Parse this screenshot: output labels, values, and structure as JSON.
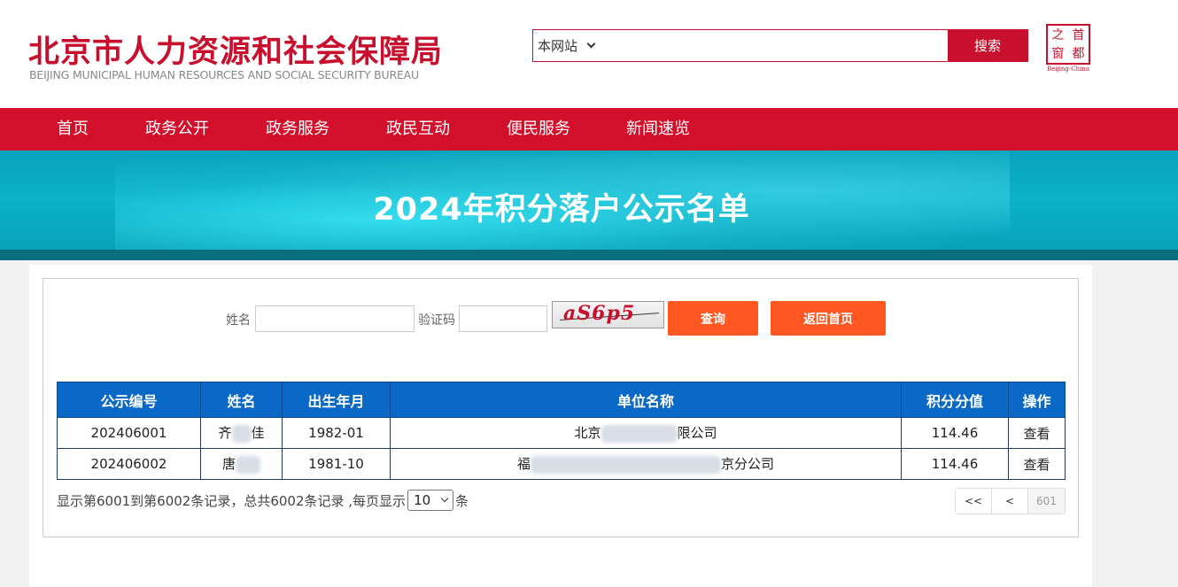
{
  "header": {
    "title_cn": "北京市人力资源和社会保障局",
    "title_en": "BEIJING MUNICIPAL HUMAN RESOURCES AND SOCIAL SECURITY BUREAU",
    "search": {
      "scope": "本网站",
      "placeholder": "",
      "button": "搜索"
    },
    "capital_logo": {
      "chars": [
        "之",
        "首",
        "窗",
        "都"
      ],
      "en": "Beijing-China"
    }
  },
  "nav": {
    "items": [
      "首页",
      "政务公开",
      "政务服务",
      "政民互动",
      "便民服务",
      "新闻速览"
    ]
  },
  "banner": {
    "title": "2024年积分落户公示名单"
  },
  "query": {
    "name_label": "姓名",
    "code_label": "验证码",
    "captcha_text": "aS6p5",
    "query_button": "查询",
    "home_button": "返回首页"
  },
  "table": {
    "headers": [
      "公示编号",
      "姓名",
      "出生年月",
      "单位名称",
      "积分分值",
      "操作"
    ],
    "rows": [
      {
        "id": "202406001",
        "name_start": "齐",
        "name_end": "佳",
        "birth": "1982-01",
        "company_start": "北京",
        "company_end": "限公司",
        "score": "114.46",
        "action": "查看"
      },
      {
        "id": "202406002",
        "name_start": "唐",
        "name_end": "",
        "birth": "1981-10",
        "company_start": "福",
        "company_end": "京分公司",
        "score": "114.46",
        "action": "查看"
      }
    ]
  },
  "pager": {
    "prefix": "显示第6001到第6002条记录，总共6002条记录 ,每页显示",
    "page_size": "10",
    "suffix": "条",
    "first": "<<",
    "prev": "<",
    "current": "601"
  },
  "colors": {
    "brand_red": "#d3102b",
    "table_header": "#0a69c7",
    "button_orange": "#ff5722",
    "banner": "#0bb2c8"
  }
}
